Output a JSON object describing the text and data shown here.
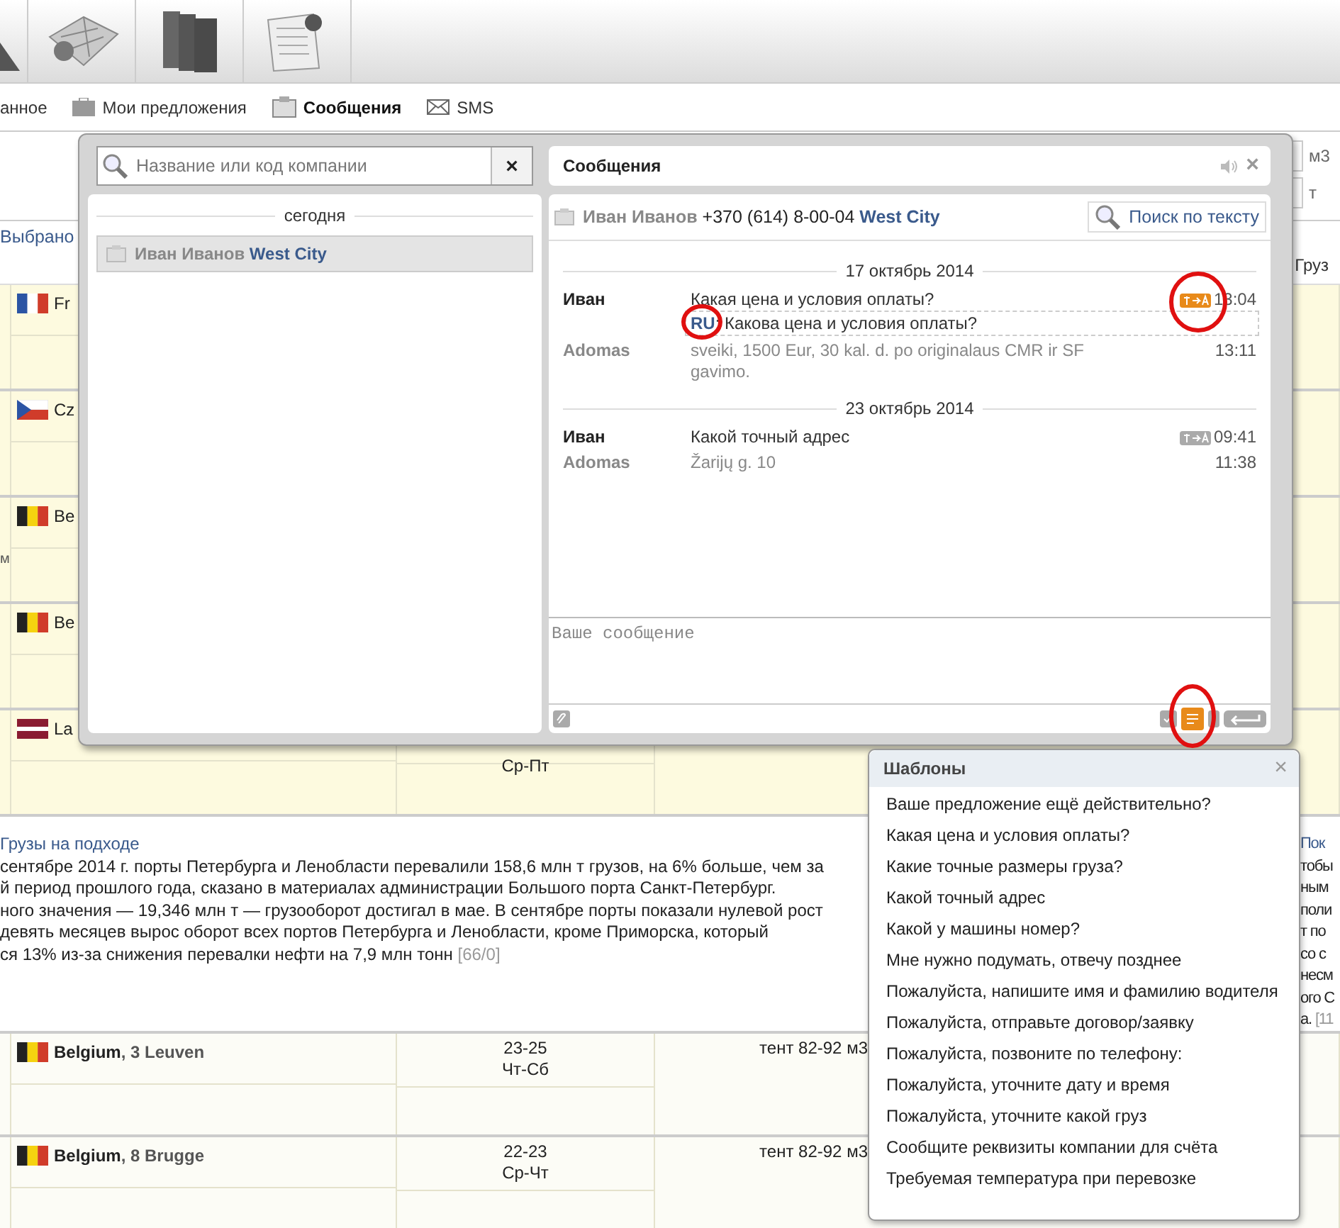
{
  "nav": [
    {
      "label": "анное",
      "selected": false
    },
    {
      "label": "Мои предложения",
      "selected": false
    },
    {
      "label": "Сообщения",
      "selected": true
    },
    {
      "label": "SMS",
      "selected": false
    }
  ],
  "filters": {
    "volume_unit": "м3",
    "weight_unit": "т"
  },
  "table": {
    "header_left": "Выбрано",
    "header_right": "Груз",
    "rows": [
      {
        "kind": "france",
        "country": "Fr"
      },
      {
        "kind": "czechia",
        "country": "Cz"
      },
      {
        "kind": "belgium",
        "country": "Be",
        "note": "м"
      },
      {
        "kind": "belgium",
        "country": "Be"
      },
      {
        "kind": "latvia",
        "country": "La",
        "days": "Ср-Пт"
      }
    ]
  },
  "news": {
    "title": "Грузы на подходе",
    "lines": [
      "сентябре 2014 г. порты Петербурга и Ленобласти перевалили 158,6 млн т грузов, на 6% больше, чем за",
      "й период прошлого года, сказано в материалах администрации Большого порта Санкт-Петербург.",
      "ного значения — 19,346 млн т — грузооборот достигал в мае. В сентябре порты показали нулевой рост",
      "девять месяцев вырос оборот всех портов Петербурга и Ленобласти, кроме Приморска, который",
      "ся 13% из-за снижения перевалки нефти на 7,9 млн тонн"
    ],
    "counter": "[66/0]",
    "right_title": "Пок",
    "right_lines": [
      "тобы",
      "ным",
      "поли",
      "т по",
      "со с",
      "несм",
      "ого С"
    ],
    "right_last": "а.",
    "right_counter": "[11"
  },
  "bottom_rows": [
    {
      "kind": "belgium",
      "place": "**Belgium**, 3 Leuven",
      "dates": "23-25",
      "days": "Чт-Сб",
      "cargo": "тент 82-92 м3"
    },
    {
      "kind": "belgium",
      "place": "**Belgium**, 8 Brugge",
      "dates": "22-23",
      "days": "Ср-Чт",
      "cargo": "тент 82-92 м3"
    }
  ],
  "chat": {
    "search": {
      "placeholder": "Название или код компании",
      "clear": "×"
    },
    "group_label": "сегодня",
    "contacts": [
      {
        "name": "Иван Иванов",
        "company": "West City",
        "selected": true
      }
    ],
    "title": "Сообщения",
    "close": "×",
    "contact": {
      "name": "Иван Иванов",
      "phone": "+370 (614) 8-00-04",
      "company": "West City"
    },
    "search_button": "Поиск по тексту",
    "days": [
      {
        "date": "17 октябрь 2014",
        "messages": [
          {
            "kind": "out",
            "author": "Иван",
            "text": "Какая цена и условия оплаты?",
            "time": "13:04",
            "translated": true,
            "translation": "**RU**: Какова цена и условия оплаты?"
          },
          {
            "kind": "in",
            "author": "Adomas",
            "text": "sveiki, 1500 Eur, 30 kal. d. po originalaus CMR ir SF gavimo.",
            "time": "13:11"
          }
        ]
      },
      {
        "date": "23 октябрь 2014",
        "messages": [
          {
            "kind": "out",
            "author": "Иван",
            "text": "Какой точный адрес",
            "time": "09:41",
            "translated": false
          },
          {
            "kind": "in",
            "author": "Adomas",
            "text": "Žarijų g. 10",
            "time": "11:38"
          }
        ]
      }
    ],
    "composer": {
      "placeholder": "Ваше сообщение"
    },
    "templates_open": true
  },
  "templates": {
    "title": "Шаблоны",
    "close": "×",
    "items": [
      "Ваше предложение ещё действительно?",
      "Какая цена и условия оплаты?",
      "Какие точные размеры груза?",
      "Какой точный адрес",
      "Какой у машины номер?",
      "Мне нужно подумать, отвечу позднее",
      "Пожалуйста, напишите имя и фамилию водителя",
      "Пожалуйста, отправьте договор/заявку",
      "Пожалуйста, позвоните по телефону:",
      "Пожалуйста, уточните дату и время",
      "Пожалуйста, уточните какой груз",
      "Сообщите реквизиты компании для счёта",
      "Требуемая температура при перевозке"
    ]
  }
}
